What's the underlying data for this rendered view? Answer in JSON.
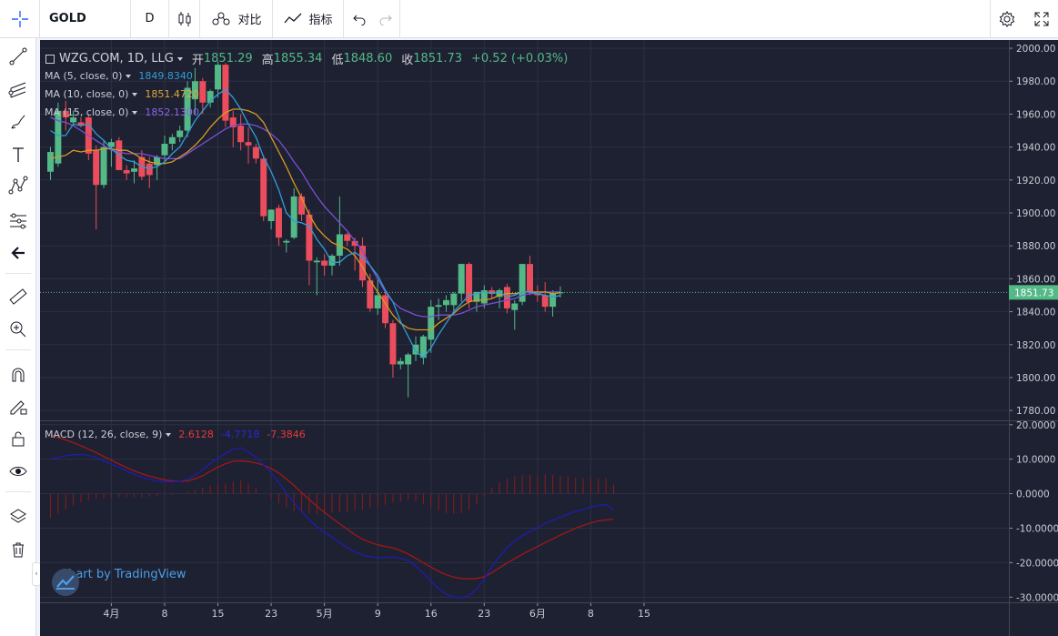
{
  "toolbar": {
    "symbol": "GOLD",
    "interval": "D",
    "compare_label": "对比",
    "indicators_label": "指标"
  },
  "legend": {
    "title": "WZG.COM, 1D, LLG",
    "open_label": "开",
    "open": "1851.29",
    "high_label": "高",
    "high": "1855.34",
    "low_label": "低",
    "low": "1848.60",
    "close_label": "收",
    "close": "1851.73",
    "change": "+0.52 (+0.03%)",
    "ma5_label": "MA (5, close, 0)",
    "ma5_value": "1849.8340",
    "ma10_label": "MA (10, close, 0)",
    "ma10_value": "1851.4720",
    "ma15_label": "MA (15, close, 0)",
    "ma15_value": "1852.1300",
    "macd_label": "MACD (12, 26, close, 9)",
    "macd_hist": "2.6128",
    "macd_line": "-4.7718",
    "macd_signal": "-7.3846"
  },
  "price_tag": "1851.73",
  "watermark": "Chart by TradingView",
  "colors": {
    "background": "#1e2131",
    "grid": "#2c3144",
    "up": "#53b987",
    "down": "#eb4d5c",
    "ma5": "#2f9ed8",
    "ma10": "#d79a22",
    "ma15": "#7a50d6",
    "macd": "#1d1db0",
    "signal": "#a11818",
    "hist": "#8c1a1a",
    "axis_text": "#c9ccd6",
    "price_line": "#53b987"
  },
  "chart_data": {
    "type": "candlestick",
    "price_axis": {
      "ticks": [
        "2000.00",
        "1980.00",
        "1960.00",
        "1940.00",
        "1920.00",
        "1900.00",
        "1880.00",
        "1860.00",
        "1840.00",
        "1820.00",
        "1800.00",
        "1780.00"
      ],
      "range": [
        1774,
        2005
      ]
    },
    "macd_axis": {
      "ticks": [
        "20.0000",
        "10.0000",
        "0.0000",
        "-10.0000",
        "-20.0000",
        "-30.0000"
      ],
      "range": [
        -31.5,
        21.0
      ]
    },
    "x_axis": {
      "labels": [
        "4月",
        "8",
        "15",
        "23",
        "5月",
        "9",
        "16",
        "23",
        "6月",
        "8",
        "15"
      ],
      "label_bar_index": [
        8,
        15,
        22,
        29,
        36,
        43,
        50,
        57,
        64,
        71,
        78
      ]
    },
    "candles": [
      {
        "o": 1925,
        "h": 1940,
        "l": 1920,
        "c": 1937
      },
      {
        "o": 1930,
        "h": 1967,
        "l": 1928,
        "c": 1962
      },
      {
        "o": 1962,
        "h": 1968,
        "l": 1950,
        "c": 1958
      },
      {
        "o": 1955,
        "h": 1962,
        "l": 1953,
        "c": 1958
      },
      {
        "o": 1955,
        "h": 1958,
        "l": 1952,
        "c": 1953
      },
      {
        "o": 1958,
        "h": 1960,
        "l": 1932,
        "c": 1936
      },
      {
        "o": 1938,
        "h": 1941,
        "l": 1890,
        "c": 1917
      },
      {
        "o": 1917,
        "h": 1944,
        "l": 1915,
        "c": 1940
      },
      {
        "o": 1940,
        "h": 1945,
        "l": 1928,
        "c": 1943
      },
      {
        "o": 1944,
        "h": 1946,
        "l": 1928,
        "c": 1926
      },
      {
        "o": 1926,
        "h": 1929,
        "l": 1920,
        "c": 1924
      },
      {
        "o": 1925,
        "h": 1932,
        "l": 1918,
        "c": 1927
      },
      {
        "o": 1934,
        "h": 1938,
        "l": 1920,
        "c": 1922
      },
      {
        "o": 1930,
        "h": 1934,
        "l": 1915,
        "c": 1923
      },
      {
        "o": 1929,
        "h": 1935,
        "l": 1920,
        "c": 1934
      },
      {
        "o": 1935,
        "h": 1947,
        "l": 1930,
        "c": 1942
      },
      {
        "o": 1942,
        "h": 1948,
        "l": 1938,
        "c": 1946
      },
      {
        "o": 1946,
        "h": 1953,
        "l": 1943,
        "c": 1950
      },
      {
        "o": 1950,
        "h": 1980,
        "l": 1946,
        "c": 1976
      },
      {
        "o": 1969,
        "h": 1988,
        "l": 1960,
        "c": 1980
      },
      {
        "o": 1980,
        "h": 1982,
        "l": 1960,
        "c": 1967
      },
      {
        "o": 1967,
        "h": 1975,
        "l": 1964,
        "c": 1974
      },
      {
        "o": 1975,
        "h": 1992,
        "l": 1970,
        "c": 1990
      },
      {
        "o": 1990,
        "h": 1991,
        "l": 1952,
        "c": 1956
      },
      {
        "o": 1958,
        "h": 1962,
        "l": 1940,
        "c": 1952
      },
      {
        "o": 1953,
        "h": 1960,
        "l": 1938,
        "c": 1943
      },
      {
        "o": 1943,
        "h": 1952,
        "l": 1930,
        "c": 1941
      },
      {
        "o": 1940,
        "h": 1942,
        "l": 1930,
        "c": 1933
      },
      {
        "o": 1933,
        "h": 1935,
        "l": 1895,
        "c": 1898
      },
      {
        "o": 1895,
        "h": 1902,
        "l": 1890,
        "c": 1902
      },
      {
        "o": 1903,
        "h": 1905,
        "l": 1880,
        "c": 1885
      },
      {
        "o": 1882,
        "h": 1884,
        "l": 1876,
        "c": 1883
      },
      {
        "o": 1885,
        "h": 1915,
        "l": 1884,
        "c": 1910
      },
      {
        "o": 1910,
        "h": 1912,
        "l": 1895,
        "c": 1899
      },
      {
        "o": 1899,
        "h": 1902,
        "l": 1856,
        "c": 1871
      },
      {
        "o": 1870,
        "h": 1873,
        "l": 1850,
        "c": 1871
      },
      {
        "o": 1871,
        "h": 1875,
        "l": 1862,
        "c": 1868
      },
      {
        "o": 1868,
        "h": 1875,
        "l": 1862,
        "c": 1874
      },
      {
        "o": 1874,
        "h": 1910,
        "l": 1868,
        "c": 1887
      },
      {
        "o": 1887,
        "h": 1888,
        "l": 1880,
        "c": 1883
      },
      {
        "o": 1883,
        "h": 1885,
        "l": 1865,
        "c": 1880
      },
      {
        "o": 1880,
        "h": 1885,
        "l": 1855,
        "c": 1859
      },
      {
        "o": 1859,
        "h": 1863,
        "l": 1840,
        "c": 1842
      },
      {
        "o": 1842,
        "h": 1860,
        "l": 1838,
        "c": 1850
      },
      {
        "o": 1850,
        "h": 1852,
        "l": 1830,
        "c": 1833
      },
      {
        "o": 1833,
        "h": 1835,
        "l": 1800,
        "c": 1808
      },
      {
        "o": 1808,
        "h": 1812,
        "l": 1805,
        "c": 1810
      },
      {
        "o": 1808,
        "h": 1815,
        "l": 1788,
        "c": 1814
      },
      {
        "o": 1814,
        "h": 1825,
        "l": 1810,
        "c": 1820
      },
      {
        "o": 1812,
        "h": 1826,
        "l": 1808,
        "c": 1825
      },
      {
        "o": 1823,
        "h": 1847,
        "l": 1815,
        "c": 1843
      },
      {
        "o": 1843,
        "h": 1848,
        "l": 1835,
        "c": 1844
      },
      {
        "o": 1844,
        "h": 1850,
        "l": 1840,
        "c": 1847
      },
      {
        "o": 1844,
        "h": 1852,
        "l": 1840,
        "c": 1851
      },
      {
        "o": 1851,
        "h": 1869,
        "l": 1846,
        "c": 1869
      },
      {
        "o": 1869,
        "h": 1870,
        "l": 1842,
        "c": 1846
      },
      {
        "o": 1846,
        "h": 1852,
        "l": 1840,
        "c": 1852
      },
      {
        "o": 1845,
        "h": 1856,
        "l": 1842,
        "c": 1853
      },
      {
        "o": 1853,
        "h": 1855,
        "l": 1848,
        "c": 1851
      },
      {
        "o": 1849,
        "h": 1854,
        "l": 1842,
        "c": 1853
      },
      {
        "o": 1855,
        "h": 1857,
        "l": 1839,
        "c": 1842
      },
      {
        "o": 1841,
        "h": 1847,
        "l": 1829,
        "c": 1845
      },
      {
        "o": 1846,
        "h": 1868,
        "l": 1844,
        "c": 1869
      },
      {
        "o": 1869,
        "h": 1874,
        "l": 1850,
        "c": 1852
      },
      {
        "o": 1851,
        "h": 1856,
        "l": 1846,
        "c": 1850
      },
      {
        "o": 1850,
        "h": 1858,
        "l": 1840,
        "c": 1843
      },
      {
        "o": 1843,
        "h": 1853,
        "l": 1837,
        "c": 1851
      },
      {
        "o": 1851.29,
        "h": 1855.34,
        "l": 1848.6,
        "c": 1851.73
      }
    ],
    "ma5": [
      1950,
      1947,
      1947,
      1954,
      1953,
      1954,
      1948,
      1944,
      1939,
      1935,
      1932,
      1931,
      1928,
      1927,
      1928,
      1931,
      1936,
      1940,
      1948,
      1956,
      1962,
      1968,
      1972,
      1975,
      1970,
      1963,
      1954,
      1946,
      1934,
      1925,
      1914,
      1900,
      1895,
      1894,
      1892,
      1884,
      1878,
      1870,
      1870,
      1874,
      1876,
      1873,
      1868,
      1862,
      1853,
      1846,
      1834,
      1825,
      1816,
      1812,
      1818,
      1826,
      1833,
      1840,
      1845,
      1850,
      1851,
      1852,
      1851,
      1852,
      1849,
      1850,
      1852,
      1852,
      1851,
      1850,
      1849,
      1849.83
    ],
    "ma10": [
      1933,
      1934,
      1935,
      1938,
      1937,
      1938,
      1938,
      1939,
      1939,
      1938,
      1938,
      1936,
      1933,
      1931,
      1930,
      1930,
      1931,
      1934,
      1937,
      1941,
      1946,
      1952,
      1957,
      1961,
      1963,
      1963,
      1962,
      1960,
      1955,
      1946,
      1937,
      1928,
      1918,
      1909,
      1899,
      1891,
      1886,
      1882,
      1880,
      1878,
      1874,
      1867,
      1859,
      1852,
      1845,
      1838,
      1833,
      1830,
      1829,
      1829,
      1829,
      1833,
      1836,
      1839,
      1843,
      1846,
      1847,
      1847,
      1848,
      1850,
      1851,
      1851,
      1852,
      1852,
      1852,
      1852,
      1851,
      1851.47
    ],
    "ma15": [
      1958,
      1956,
      1955,
      1953,
      1950,
      1947,
      1944,
      1941,
      1938,
      1937,
      1936,
      1936,
      1936,
      1935,
      1934,
      1933,
      1933,
      1933,
      1936,
      1939,
      1942,
      1945,
      1948,
      1951,
      1953,
      1954,
      1954,
      1953,
      1951,
      1948,
      1944,
      1938,
      1931,
      1925,
      1917,
      1910,
      1904,
      1899,
      1894,
      1889,
      1883,
      1877,
      1868,
      1860,
      1852,
      1846,
      1842,
      1840,
      1838,
      1837,
      1837,
      1838,
      1838,
      1838,
      1839,
      1841,
      1843,
      1844,
      1845,
      1846,
      1847,
      1848,
      1850,
      1851,
      1851,
      1852,
      1852,
      1852.13
    ],
    "macd": [
      10.0,
      10.5,
      11.0,
      11.3,
      11.4,
      11.1,
      10.5,
      9.5,
      8.6,
      7.6,
      6.6,
      5.6,
      4.8,
      4.2,
      3.7,
      3.5,
      3.4,
      3.6,
      4.2,
      5.4,
      7.0,
      8.8,
      10.3,
      11.6,
      12.9,
      13.3,
      12.2,
      10.5,
      8.4,
      6.0,
      3.2,
      0.3,
      -2.6,
      -5.2,
      -7.6,
      -9.6,
      -11.2,
      -12.6,
      -14.1,
      -15.6,
      -16.8,
      -17.8,
      -18.3,
      -18.6,
      -18.5,
      -18.3,
      -18.8,
      -19.3,
      -21.0,
      -23.0,
      -25.4,
      -27.4,
      -29.1,
      -30.0,
      -30.2,
      -29.5,
      -27.7,
      -24.7,
      -21.2,
      -18.2,
      -15.6,
      -13.7,
      -12.2,
      -10.9,
      -9.9,
      -8.6,
      -7.7,
      -6.8,
      -5.9,
      -5.2,
      -4.6,
      -3.9,
      -3.4,
      -3.1,
      -4.77
    ],
    "signal": [
      17.0,
      16.3,
      15.6,
      14.8,
      13.9,
      12.9,
      11.9,
      10.8,
      9.7,
      8.6,
      7.6,
      6.6,
      5.8,
      5.1,
      4.5,
      4.0,
      3.7,
      3.6,
      3.7,
      4.3,
      5.2,
      6.5,
      7.7,
      8.7,
      9.4,
      9.5,
      9.3,
      8.9,
      8.3,
      7.3,
      6.0,
      4.3,
      2.4,
      0.3,
      -1.7,
      -3.6,
      -5.4,
      -7.1,
      -8.7,
      -10.3,
      -11.9,
      -13.2,
      -14.1,
      -14.8,
      -15.3,
      -15.7,
      -16.5,
      -17.5,
      -18.7,
      -20.0,
      -21.3,
      -22.5,
      -23.5,
      -24.2,
      -24.6,
      -24.7,
      -24.6,
      -24.1,
      -22.9,
      -21.5,
      -20.1,
      -18.8,
      -17.6,
      -16.4,
      -15.3,
      -14.2,
      -13.1,
      -12.0,
      -11.0,
      -10.0,
      -9.2,
      -8.5,
      -7.9,
      -7.6,
      -7.38
    ]
  }
}
